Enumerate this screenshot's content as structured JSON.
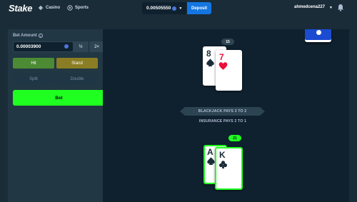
{
  "header": {
    "logo": "Stake",
    "nav": [
      {
        "label": "Casino",
        "icon": "casino-icon"
      },
      {
        "label": "Sports",
        "icon": "sports-icon"
      }
    ],
    "balance": "0.00505550",
    "deposit_label": "Deposit",
    "username": "ahmedcena227"
  },
  "bet_panel": {
    "bet_amount_label": "Bet Amount",
    "bet_amount_value": "0.00003900",
    "half_label": "½",
    "double_label": "2×",
    "hit_label": "Hit",
    "stand_label": "Stand",
    "split_label": "Split",
    "double_down_label": "Double",
    "bet_label": "Bet"
  },
  "game": {
    "dealer_score": "15",
    "dealer_cards": [
      {
        "rank": "8",
        "suit": "spade",
        "color": "#1a2c38"
      },
      {
        "rank": "7",
        "suit": "heart",
        "color": "#e9113c"
      }
    ],
    "info_line_1": "BLACKJACK PAYS 3 TO 2",
    "info_line_2": "INSURANCE PAYS 2 TO 1",
    "player_score": "21",
    "player_cards": [
      {
        "rank": "A",
        "suit": "spade",
        "color": "#1a2c38"
      },
      {
        "rank": "K",
        "suit": "club",
        "color": "#1a2c38"
      }
    ]
  },
  "colors": {
    "bg": "#1a2c38",
    "panel": "#213743",
    "game_bg": "#0f212e",
    "accent_green": "#1fff20",
    "deposit_blue": "#1475e1"
  }
}
